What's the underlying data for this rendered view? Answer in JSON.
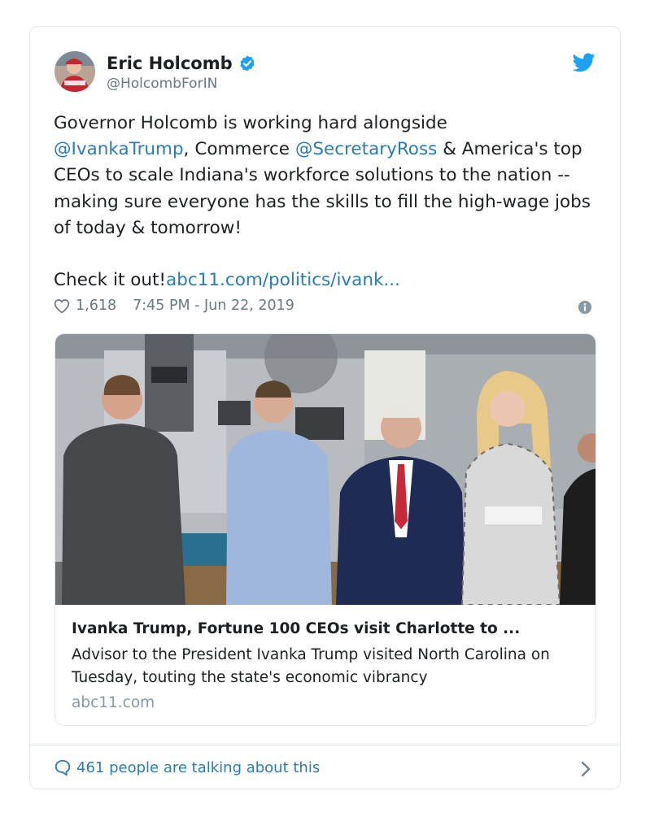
{
  "author": {
    "name": "Eric Holcomb",
    "handle": "@HolcombForIN",
    "verified": true,
    "avatar_text": "Holcomb"
  },
  "icons": {
    "verified": "verified-badge-icon",
    "brand": "twitter-bird-icon",
    "like": "heart-icon",
    "info": "info-icon",
    "reply": "speech-bubble-icon",
    "more": "chevron-right-icon"
  },
  "tweet": {
    "text_line1": "Governor Holcomb is working hard alongside",
    "mention_ivanka": "@IvankaTrump",
    "text_commerce": ", Commerce ",
    "mention_ross": "@SecretaryRoss",
    "text_rest": " & America's top CEOs to scale Indiana's workforce solutions to the nation -- making sure everyone has the skills to fill the high-wage jobs of today & tomorrow!",
    "text_check": "Check it out!",
    "link": "abc11.com/politics/ivank..."
  },
  "meta": {
    "likes": "1,618",
    "timestamp": "7:45 PM - Jun 22, 2019"
  },
  "link_card": {
    "title": "Ivanka Trump, Fortune 100 CEOs visit Charlotte to ...",
    "description": "Advisor to the President Ivanka Trump visited North Carolina on Tuesday, touting the state's economic vibrancy",
    "domain": "abc11.com"
  },
  "footer": {
    "conversation": "461 people are talking about this"
  },
  "colors": {
    "link": "#2b7bb9",
    "secondary_text": "#697882",
    "border": "#e1e8ed",
    "twitter_blue": "#1da1f2"
  }
}
